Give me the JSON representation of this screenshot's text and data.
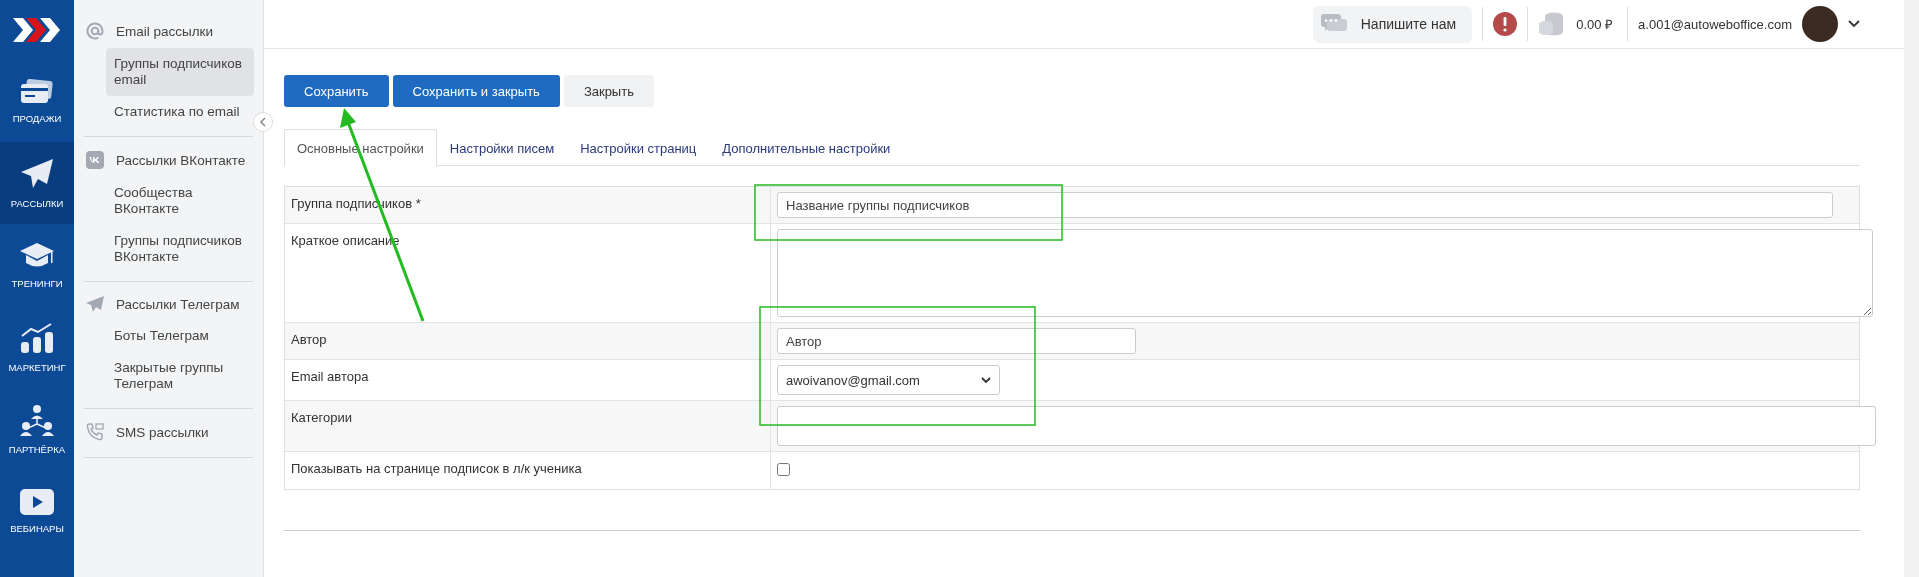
{
  "nav_rail": [
    {
      "label": "ПРОДАЖИ",
      "selected": false
    },
    {
      "label": "РАССЫЛКИ",
      "selected": true
    },
    {
      "label": "ТРЕНИНГИ",
      "selected": false
    },
    {
      "label": "МАРКЕТИНГ",
      "selected": false
    },
    {
      "label": "ПАРТНЁРКА",
      "selected": false
    },
    {
      "label": "ВЕБИНАРЫ",
      "selected": false
    }
  ],
  "submenu": [
    {
      "title": "Email рассылки",
      "children": [
        {
          "label": "Группы подписчиков email",
          "selected": true
        },
        {
          "label": "Статистика по email",
          "selected": false
        }
      ]
    },
    {
      "title": "Рассылки ВКонтакте",
      "children": [
        {
          "label": "Сообщества ВКонтакте",
          "selected": false
        },
        {
          "label": "Группы подписчиков ВКонтакте",
          "selected": false
        }
      ]
    },
    {
      "title": "Рассылки Телеграм",
      "children": [
        {
          "label": "Боты Телеграм",
          "selected": false
        },
        {
          "label": "Закрытые группы Телеграм",
          "selected": false
        }
      ]
    },
    {
      "title": "SMS рассылки"
    }
  ],
  "top_bar": {
    "contact_button": "Напишите нам",
    "balance": "0.00 ₽",
    "user_email": "a.001@autoweboffice.com"
  },
  "buttons": [
    {
      "label": "Сохранить",
      "kind": "primary"
    },
    {
      "label": "Сохранить и закрыть",
      "kind": "primary"
    },
    {
      "label": "Закрыть",
      "kind": "secondary"
    }
  ],
  "tabs": [
    {
      "label": "Основные настройки",
      "selected": true
    },
    {
      "label": "Настройки писем",
      "selected": false
    },
    {
      "label": "Настройки страниц",
      "selected": false
    },
    {
      "label": "Дополнительные настройки",
      "selected": false
    }
  ],
  "form": [
    {
      "kind": "text",
      "label": "Группа подписчиков *",
      "placeholder": "Название группы подписчиков"
    },
    {
      "kind": "textarea",
      "label": "Краткое описание"
    },
    {
      "kind": "short_text",
      "label": "Автор",
      "placeholder": "Автор"
    },
    {
      "kind": "select",
      "label": "Email автора",
      "value": "awoivanov@gmail.com"
    },
    {
      "kind": "tall_text",
      "label": "Категории"
    },
    {
      "kind": "checkbox",
      "label": "Показывать на странице подписок в л/к ученика",
      "checked": false
    }
  ]
}
